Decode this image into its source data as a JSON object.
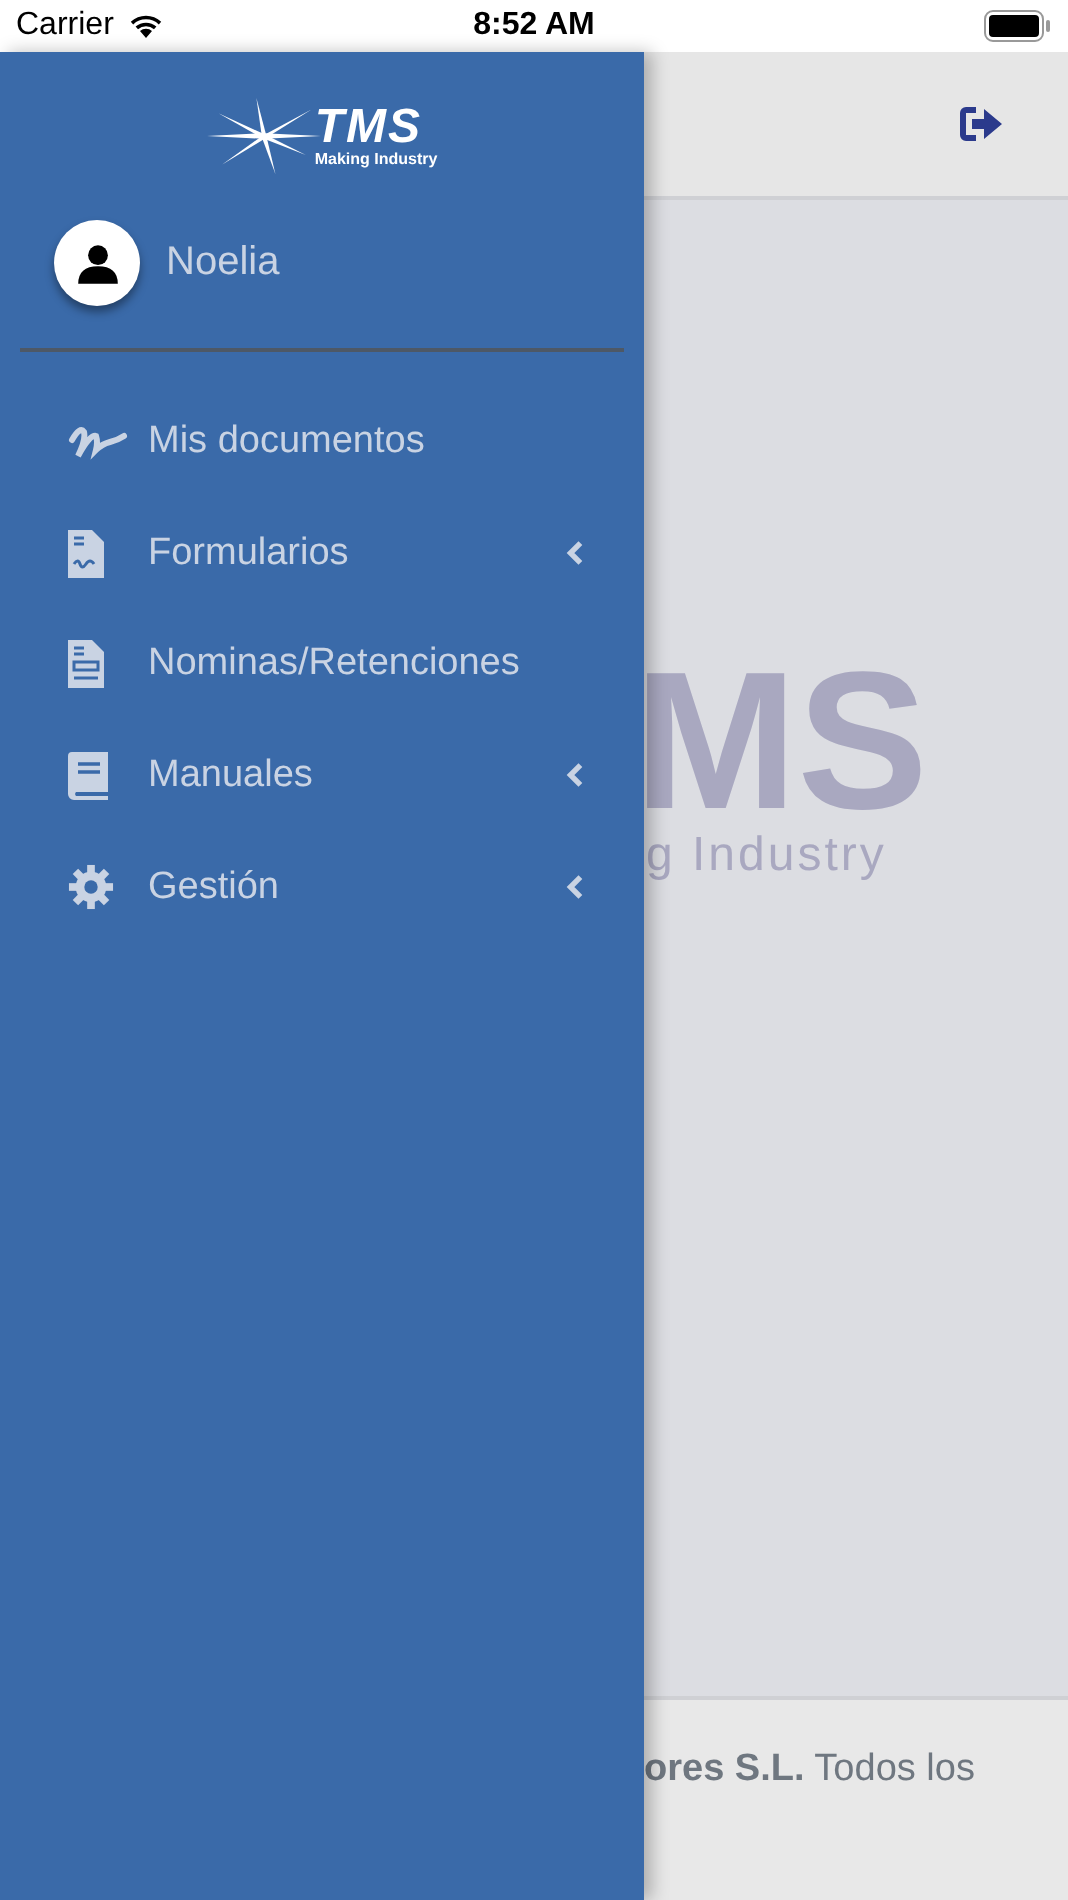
{
  "status_bar": {
    "carrier": "Carrier",
    "time": "8:52 AM"
  },
  "drawer": {
    "logo": {
      "title": "TMS",
      "subtitle": "Making Industry"
    },
    "user": {
      "name": "Noelia"
    },
    "items": [
      {
        "label": "Mis documentos",
        "kind": "signature",
        "expandable": false
      },
      {
        "label": "Formularios",
        "kind": "form",
        "expandable": true
      },
      {
        "label": "Nominas/Retenciones",
        "kind": "payslip",
        "expandable": false
      },
      {
        "label": "Manuales",
        "kind": "book",
        "expandable": true
      },
      {
        "label": "Gestión",
        "kind": "gear",
        "expandable": true
      }
    ]
  },
  "main": {
    "watermark": {
      "title": "MS",
      "subtitle": "g Industry"
    },
    "footer": "**ores S.L.** Todos los"
  }
}
